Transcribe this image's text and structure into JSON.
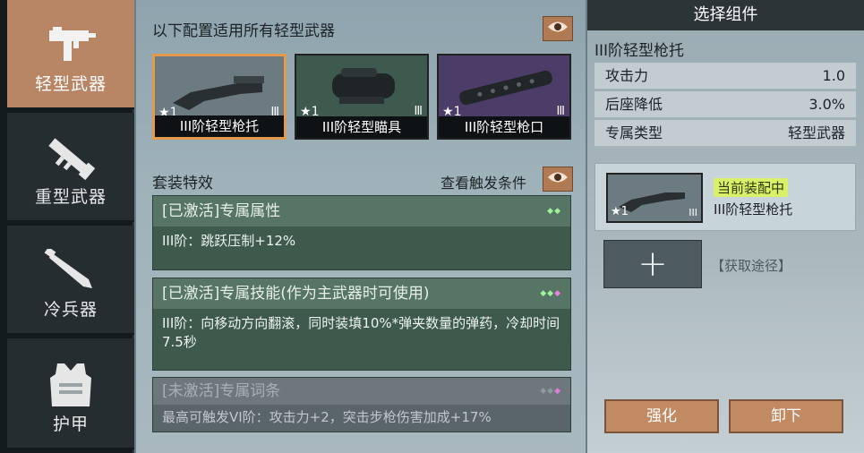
{
  "nav": {
    "items": [
      {
        "label": "轻型武器",
        "icon": "smg-icon",
        "active": true
      },
      {
        "label": "重型武器",
        "icon": "rocket-launcher-icon",
        "active": false
      },
      {
        "label": "冷兵器",
        "icon": "machete-icon",
        "active": false
      },
      {
        "label": "护甲",
        "icon": "vest-icon",
        "active": false
      }
    ]
  },
  "config": {
    "title": "以下配置适用所有轻型武器",
    "eye_icon": "eye-icon",
    "parts": [
      {
        "name": "III阶轻型枪托",
        "stars": "1",
        "tier": "III",
        "bg": "#6c7b82"
      },
      {
        "name": "III阶轻型瞄具",
        "stars": "1",
        "tier": "III",
        "bg": "#3e5a4f"
      },
      {
        "name": "III阶轻型枪口",
        "stars": "1",
        "tier": "III",
        "bg": "#4b3d67"
      }
    ]
  },
  "set": {
    "title": "套装特效",
    "trigger_label": "查看触发条件",
    "effects": [
      {
        "head": "[已激活]专属属性",
        "body": "III阶：跳跃压制+12%",
        "active": true
      },
      {
        "head": "[已激活]专属技能(作为主武器时可使用)",
        "body": "III阶：向移动方向翻滚，同时装填10%*弹夹数量的弹药，冷却时间7.5秒",
        "active": true
      },
      {
        "head": "[未激活]专属词条",
        "body": "最高可触发VI阶：攻击力+2，突击步枪伤害加成+17%",
        "active": false
      }
    ]
  },
  "detail": {
    "title": "选择组件",
    "item_name": "III阶轻型枪托",
    "stats": [
      {
        "key": "攻击力",
        "value": "1.0"
      },
      {
        "key": "后座降低",
        "value": "3.0%"
      },
      {
        "key": "专属类型",
        "value": "轻型武器"
      }
    ],
    "equipped_badge": "当前装配中",
    "equipped_name": "III阶轻型枪托",
    "equipped_stars": "1",
    "equipped_tier": "III",
    "add_symbol": "+",
    "acquire": "【获取途径】",
    "buttons": {
      "upgrade": "强化",
      "unequip": "卸下"
    }
  }
}
